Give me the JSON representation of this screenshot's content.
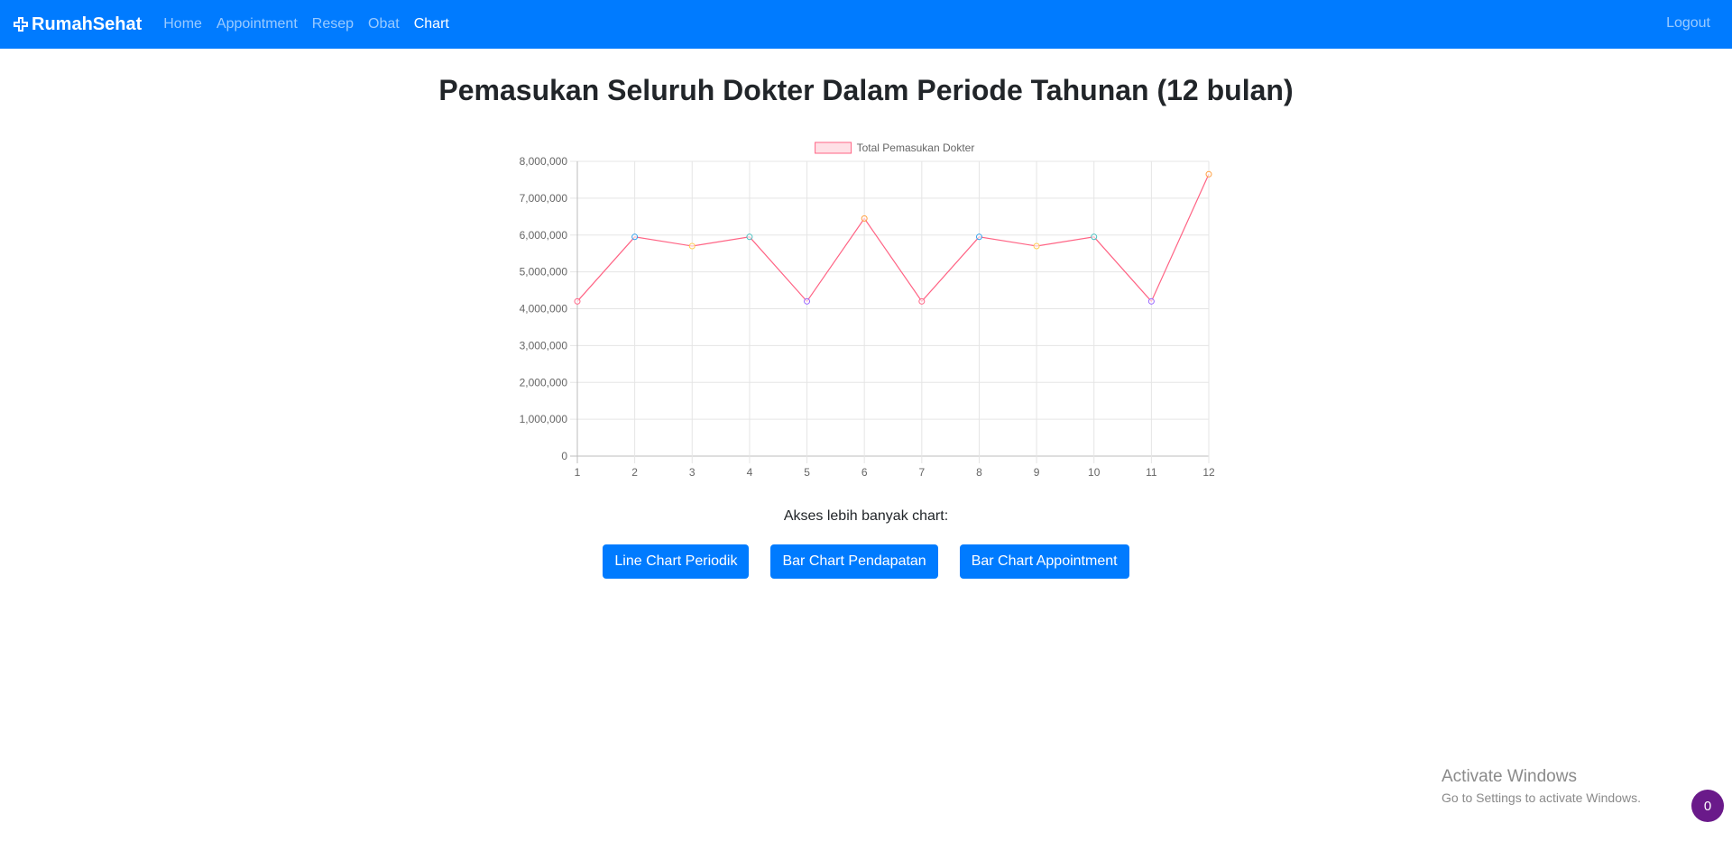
{
  "navbar": {
    "brand": "RumahSehat",
    "links": [
      "Home",
      "Appointment",
      "Resep",
      "Obat",
      "Chart"
    ],
    "active_link": "Chart",
    "logout": "Logout",
    "color": "#007bff"
  },
  "page": {
    "title": "Pemasukan Seluruh Dokter Dalam Periode Tahunan (12 bulan)",
    "more_text": "Akses lebih banyak chart:",
    "buttons": [
      "Line Chart Periodik",
      "Bar Chart Pendapatan",
      "Bar Chart Appointment"
    ]
  },
  "chart_data": {
    "type": "line",
    "title": "",
    "xlabel": "",
    "ylabel": "",
    "categories": [
      "1",
      "2",
      "3",
      "4",
      "5",
      "6",
      "7",
      "8",
      "9",
      "10",
      "11",
      "12"
    ],
    "series": [
      {
        "name": "Total Pemasukan Dokter",
        "values": [
          4200000,
          5950000,
          5700000,
          5950000,
          4200000,
          6450000,
          4200000,
          5950000,
          5700000,
          5950000,
          4200000,
          7650000
        ],
        "line_color": "#ff6384",
        "fill_color": "rgba(255,99,132,0.2)",
        "point_colors": [
          "#ff6384",
          "#36a2eb",
          "#ffce56",
          "#4bc0c0",
          "#9966ff",
          "#ff9f40",
          "#ff6384",
          "#36a2eb",
          "#ffce56",
          "#4bc0c0",
          "#9966ff",
          "#ff9f40"
        ]
      }
    ],
    "ylim": [
      0,
      8000000
    ],
    "yticks": [
      "0",
      "1,000,000",
      "2,000,000",
      "3,000,000",
      "4,000,000",
      "5,000,000",
      "6,000,000",
      "7,000,000",
      "8,000,000"
    ],
    "grid": true,
    "legend_position": "top"
  },
  "overlay": {
    "activate_title": "Activate Windows",
    "activate_sub": "Go to Settings to activate Windows.",
    "badge_count": "0"
  }
}
